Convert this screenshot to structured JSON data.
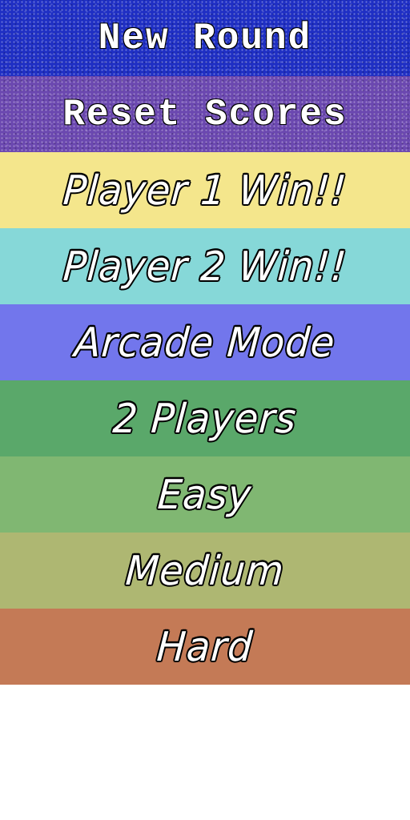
{
  "menu": {
    "items": [
      {
        "label": "New Round",
        "color": "#1f2fc4",
        "style": "mono",
        "texture": "glitter"
      },
      {
        "label": "Reset Scores",
        "color": "#6b48b0",
        "style": "mono",
        "texture": "glitter"
      },
      {
        "label": "Player 1 Win!!",
        "color": "#f4e68c",
        "style": "hand",
        "texture": "flat"
      },
      {
        "label": "Player 2 Win!!",
        "color": "#86d8d8",
        "style": "hand",
        "texture": "flat"
      },
      {
        "label": "Arcade Mode",
        "color": "#7276ec",
        "style": "hand",
        "texture": "flat"
      },
      {
        "label": "2 Players",
        "color": "#5aa86a",
        "style": "hand",
        "texture": "flat"
      },
      {
        "label": "Easy",
        "color": "#80b772",
        "style": "hand",
        "texture": "flat"
      },
      {
        "label": "Medium",
        "color": "#aeb772",
        "style": "hand",
        "texture": "flat"
      },
      {
        "label": "Hard",
        "color": "#c47a56",
        "style": "hand",
        "texture": "flat"
      }
    ]
  }
}
